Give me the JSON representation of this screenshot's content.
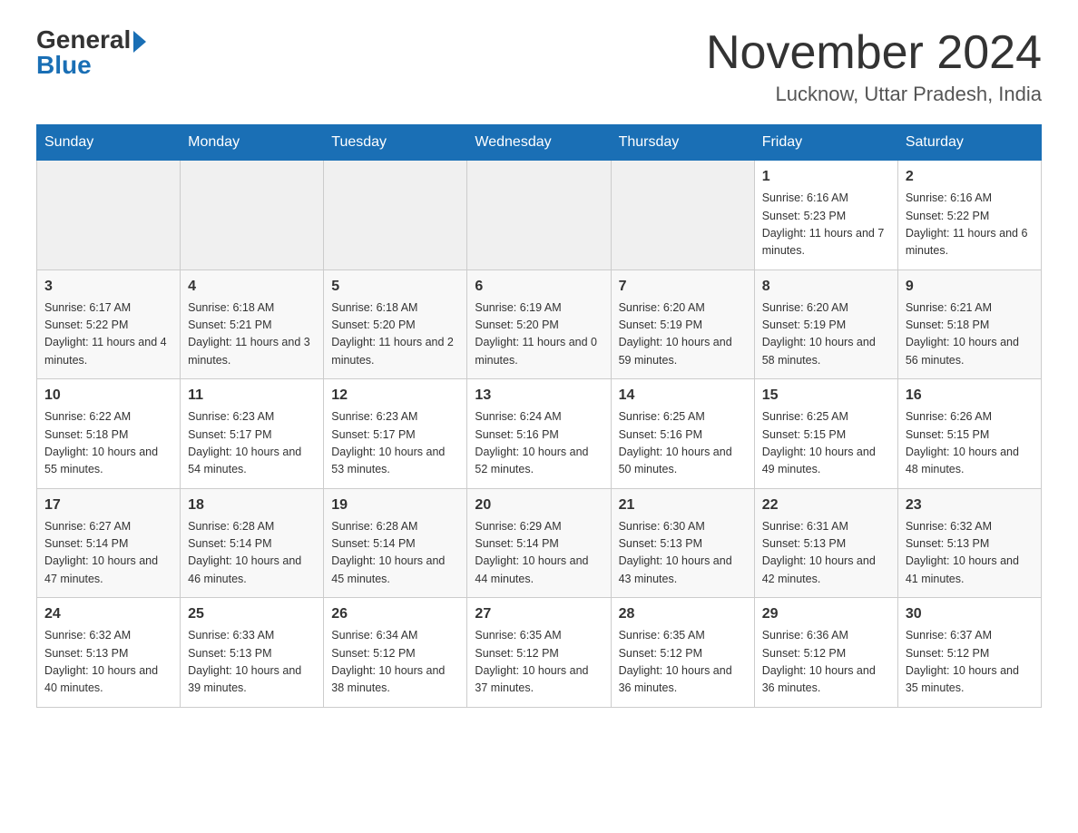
{
  "logo": {
    "general": "General",
    "blue": "Blue",
    "arrow": "▶"
  },
  "header": {
    "title": "November 2024",
    "location": "Lucknow, Uttar Pradesh, India"
  },
  "days_of_week": [
    "Sunday",
    "Monday",
    "Tuesday",
    "Wednesday",
    "Thursday",
    "Friday",
    "Saturday"
  ],
  "weeks": [
    [
      {
        "day": "",
        "info": ""
      },
      {
        "day": "",
        "info": ""
      },
      {
        "day": "",
        "info": ""
      },
      {
        "day": "",
        "info": ""
      },
      {
        "day": "",
        "info": ""
      },
      {
        "day": "1",
        "info": "Sunrise: 6:16 AM\nSunset: 5:23 PM\nDaylight: 11 hours and 7 minutes."
      },
      {
        "day": "2",
        "info": "Sunrise: 6:16 AM\nSunset: 5:22 PM\nDaylight: 11 hours and 6 minutes."
      }
    ],
    [
      {
        "day": "3",
        "info": "Sunrise: 6:17 AM\nSunset: 5:22 PM\nDaylight: 11 hours and 4 minutes."
      },
      {
        "day": "4",
        "info": "Sunrise: 6:18 AM\nSunset: 5:21 PM\nDaylight: 11 hours and 3 minutes."
      },
      {
        "day": "5",
        "info": "Sunrise: 6:18 AM\nSunset: 5:20 PM\nDaylight: 11 hours and 2 minutes."
      },
      {
        "day": "6",
        "info": "Sunrise: 6:19 AM\nSunset: 5:20 PM\nDaylight: 11 hours and 0 minutes."
      },
      {
        "day": "7",
        "info": "Sunrise: 6:20 AM\nSunset: 5:19 PM\nDaylight: 10 hours and 59 minutes."
      },
      {
        "day": "8",
        "info": "Sunrise: 6:20 AM\nSunset: 5:19 PM\nDaylight: 10 hours and 58 minutes."
      },
      {
        "day": "9",
        "info": "Sunrise: 6:21 AM\nSunset: 5:18 PM\nDaylight: 10 hours and 56 minutes."
      }
    ],
    [
      {
        "day": "10",
        "info": "Sunrise: 6:22 AM\nSunset: 5:18 PM\nDaylight: 10 hours and 55 minutes."
      },
      {
        "day": "11",
        "info": "Sunrise: 6:23 AM\nSunset: 5:17 PM\nDaylight: 10 hours and 54 minutes."
      },
      {
        "day": "12",
        "info": "Sunrise: 6:23 AM\nSunset: 5:17 PM\nDaylight: 10 hours and 53 minutes."
      },
      {
        "day": "13",
        "info": "Sunrise: 6:24 AM\nSunset: 5:16 PM\nDaylight: 10 hours and 52 minutes."
      },
      {
        "day": "14",
        "info": "Sunrise: 6:25 AM\nSunset: 5:16 PM\nDaylight: 10 hours and 50 minutes."
      },
      {
        "day": "15",
        "info": "Sunrise: 6:25 AM\nSunset: 5:15 PM\nDaylight: 10 hours and 49 minutes."
      },
      {
        "day": "16",
        "info": "Sunrise: 6:26 AM\nSunset: 5:15 PM\nDaylight: 10 hours and 48 minutes."
      }
    ],
    [
      {
        "day": "17",
        "info": "Sunrise: 6:27 AM\nSunset: 5:14 PM\nDaylight: 10 hours and 47 minutes."
      },
      {
        "day": "18",
        "info": "Sunrise: 6:28 AM\nSunset: 5:14 PM\nDaylight: 10 hours and 46 minutes."
      },
      {
        "day": "19",
        "info": "Sunrise: 6:28 AM\nSunset: 5:14 PM\nDaylight: 10 hours and 45 minutes."
      },
      {
        "day": "20",
        "info": "Sunrise: 6:29 AM\nSunset: 5:14 PM\nDaylight: 10 hours and 44 minutes."
      },
      {
        "day": "21",
        "info": "Sunrise: 6:30 AM\nSunset: 5:13 PM\nDaylight: 10 hours and 43 minutes."
      },
      {
        "day": "22",
        "info": "Sunrise: 6:31 AM\nSunset: 5:13 PM\nDaylight: 10 hours and 42 minutes."
      },
      {
        "day": "23",
        "info": "Sunrise: 6:32 AM\nSunset: 5:13 PM\nDaylight: 10 hours and 41 minutes."
      }
    ],
    [
      {
        "day": "24",
        "info": "Sunrise: 6:32 AM\nSunset: 5:13 PM\nDaylight: 10 hours and 40 minutes."
      },
      {
        "day": "25",
        "info": "Sunrise: 6:33 AM\nSunset: 5:13 PM\nDaylight: 10 hours and 39 minutes."
      },
      {
        "day": "26",
        "info": "Sunrise: 6:34 AM\nSunset: 5:12 PM\nDaylight: 10 hours and 38 minutes."
      },
      {
        "day": "27",
        "info": "Sunrise: 6:35 AM\nSunset: 5:12 PM\nDaylight: 10 hours and 37 minutes."
      },
      {
        "day": "28",
        "info": "Sunrise: 6:35 AM\nSunset: 5:12 PM\nDaylight: 10 hours and 36 minutes."
      },
      {
        "day": "29",
        "info": "Sunrise: 6:36 AM\nSunset: 5:12 PM\nDaylight: 10 hours and 36 minutes."
      },
      {
        "day": "30",
        "info": "Sunrise: 6:37 AM\nSunset: 5:12 PM\nDaylight: 10 hours and 35 minutes."
      }
    ]
  ]
}
